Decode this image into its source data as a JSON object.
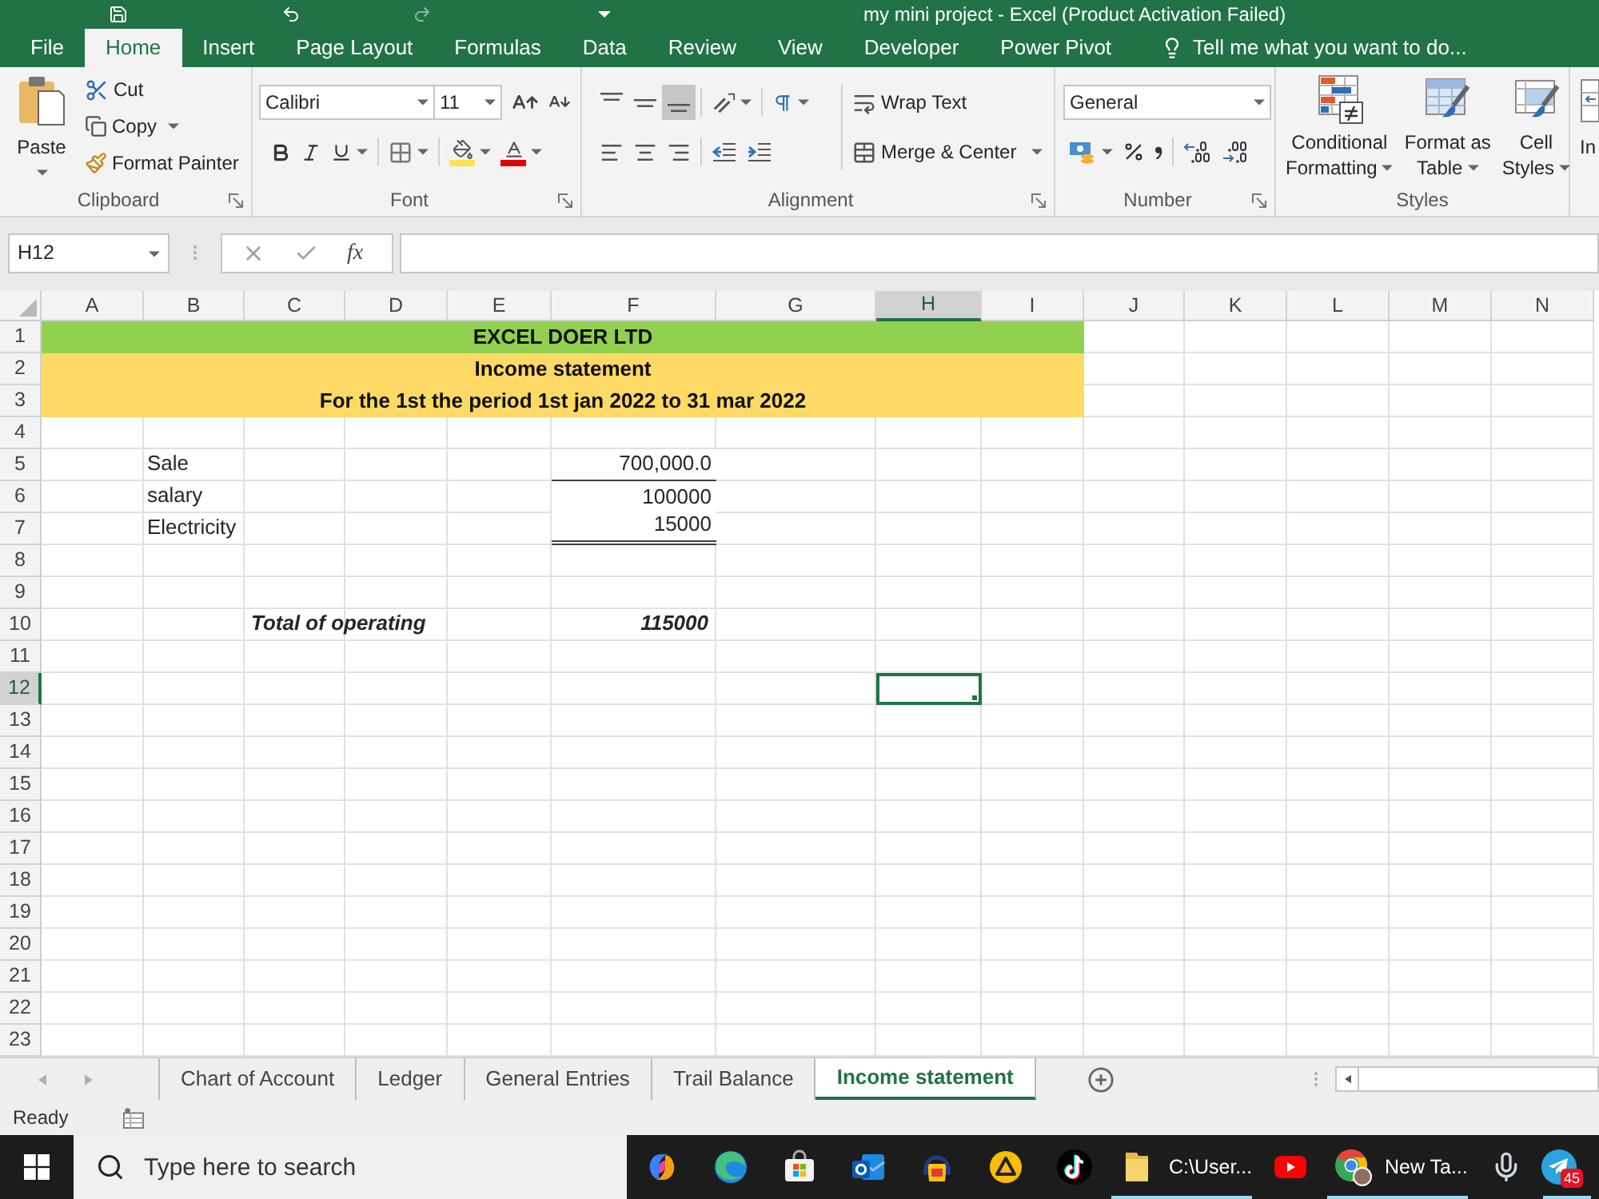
{
  "window": {
    "title": "my mini project - Excel (Product Activation Failed)"
  },
  "ribbon_tabs": [
    {
      "label": "File",
      "selected": false
    },
    {
      "label": "Home",
      "selected": true
    },
    {
      "label": "Insert",
      "selected": false
    },
    {
      "label": "Page Layout",
      "selected": false
    },
    {
      "label": "Formulas",
      "selected": false
    },
    {
      "label": "Data",
      "selected": false
    },
    {
      "label": "Review",
      "selected": false
    },
    {
      "label": "View",
      "selected": false
    },
    {
      "label": "Developer",
      "selected": false
    },
    {
      "label": "Power Pivot",
      "selected": false
    }
  ],
  "tell_me": "Tell me what you want to do...",
  "clipboard": {
    "paste": "Paste",
    "cut": "Cut",
    "copy": "Copy",
    "format_painter": "Format Painter",
    "group_label": "Clipboard"
  },
  "font": {
    "name": "Calibri",
    "size": "11",
    "group_label": "Font"
  },
  "alignment": {
    "vertical_align": [
      {
        "selected": false
      },
      {
        "selected": false
      },
      {
        "selected": true
      }
    ],
    "wrap_text": "Wrap Text",
    "merge_center": "Merge & Center",
    "group_label": "Alignment"
  },
  "number": {
    "format": "General",
    "group_label": "Number"
  },
  "styles": {
    "buttons": [
      {
        "lines": [
          "Conditional",
          "Formatting"
        ]
      },
      {
        "lines": [
          "Format as",
          "Table"
        ]
      },
      {
        "lines": [
          "Cell",
          "Styles"
        ]
      }
    ],
    "group_label": "Styles"
  },
  "cells_group": {
    "insert": "In"
  },
  "formula_bar": {
    "name_box": "H12",
    "function_label": "fx"
  },
  "sheet": {
    "columns": [
      {
        "label": "A",
        "selected": false
      },
      {
        "label": "B",
        "selected": false
      },
      {
        "label": "C",
        "selected": false
      },
      {
        "label": "D",
        "selected": false
      },
      {
        "label": "E",
        "selected": false
      },
      {
        "label": "F",
        "selected": false
      },
      {
        "label": "G",
        "selected": false
      },
      {
        "label": "H",
        "selected": true
      },
      {
        "label": "I",
        "selected": false
      },
      {
        "label": "J",
        "selected": false
      },
      {
        "label": "K",
        "selected": false
      },
      {
        "label": "L",
        "selected": false
      },
      {
        "label": "M",
        "selected": false
      },
      {
        "label": "N",
        "selected": false
      }
    ],
    "rows": [
      {
        "label": "1",
        "selected": false
      },
      {
        "label": "2",
        "selected": false
      },
      {
        "label": "3",
        "selected": false
      },
      {
        "label": "4",
        "selected": false
      },
      {
        "label": "5",
        "selected": false
      },
      {
        "label": "6",
        "selected": false
      },
      {
        "label": "7",
        "selected": false
      },
      {
        "label": "8",
        "selected": false
      },
      {
        "label": "9",
        "selected": false
      },
      {
        "label": "10",
        "selected": false
      },
      {
        "label": "11",
        "selected": false
      },
      {
        "label": "12",
        "selected": true
      },
      {
        "label": "13",
        "selected": false
      },
      {
        "label": "14",
        "selected": false
      },
      {
        "label": "15",
        "selected": false
      },
      {
        "label": "16",
        "selected": false
      },
      {
        "label": "17",
        "selected": false
      },
      {
        "label": "18",
        "selected": false
      },
      {
        "label": "19",
        "selected": false
      },
      {
        "label": "20",
        "selected": false
      },
      {
        "label": "21",
        "selected": false
      },
      {
        "label": "22",
        "selected": false
      },
      {
        "label": "23",
        "selected": false
      }
    ],
    "title_rows": [
      {
        "text": "EXCEL DOER LTD",
        "color": "#92d050"
      },
      {
        "text": "Income statement",
        "color": "#ffd966"
      },
      {
        "text": "For the 1st the period 1st jan 2022 to 31 mar 2022",
        "color": "#ffd966"
      }
    ],
    "entries": [
      {
        "label": "Sale",
        "amount": "700,000.0",
        "rule_below": true,
        "double_rule": false
      },
      {
        "label": "salary",
        "amount": "100000",
        "rule_below": false
      },
      {
        "label": "Electricity",
        "amount": "15000",
        "rule_below": true,
        "double_rule": true
      }
    ],
    "total": {
      "label": "Total of operating",
      "amount": "115000"
    }
  },
  "sheet_tabs": [
    {
      "label": "Chart of Account",
      "selected": false
    },
    {
      "label": "Ledger",
      "selected": false
    },
    {
      "label": "General Entries",
      "selected": false
    },
    {
      "label": "Trail Balance",
      "selected": false
    },
    {
      "label": "Income statement",
      "selected": true
    }
  ],
  "status_bar": {
    "text": "Ready"
  },
  "taskbar": {
    "search_placeholder": "Type here to search",
    "apps": [
      {
        "running": false
      },
      {
        "running": false
      },
      {
        "running": false
      },
      {
        "running": false
      },
      {
        "running": false
      },
      {
        "running": false
      },
      {
        "running": false
      },
      {
        "label": "C:\\User...",
        "running": true
      },
      {
        "running": false
      },
      {
        "label": "New Ta...",
        "running": true
      },
      {
        "running": false
      },
      {
        "badge": "45",
        "running": true
      }
    ]
  }
}
